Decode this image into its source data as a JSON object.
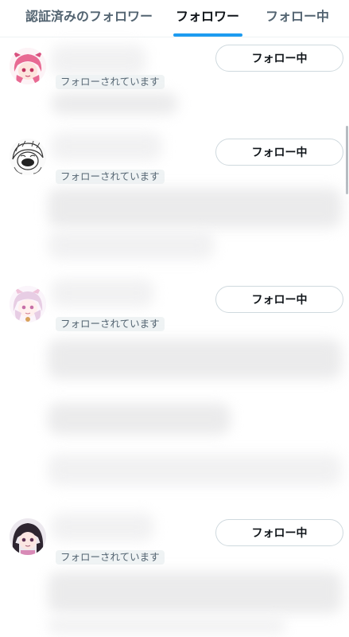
{
  "tabs": {
    "verified_followers": "認証済みのフォロワー",
    "followers": "フォロワー",
    "following": "フォロー中"
  },
  "users": [
    {
      "follow_button": "フォロー中",
      "follows_you": "フォローされています",
      "avatar_icon": "pink-anime-avatar"
    },
    {
      "follow_button": "フォロー中",
      "follows_you": "フォローされています",
      "avatar_icon": "sketch-avatar"
    },
    {
      "follow_button": "フォロー中",
      "follows_you": "フォローされています",
      "avatar_icon": "pastel-anime-avatar"
    },
    {
      "follow_button": "フォロー中",
      "follows_you": "フォローされています",
      "avatar_icon": "dark-hair-anime-avatar"
    }
  ],
  "colors": {
    "accent": "#1d9bf0",
    "text_primary": "#0f1419",
    "text_secondary": "#536471",
    "border": "#cfd9de"
  }
}
